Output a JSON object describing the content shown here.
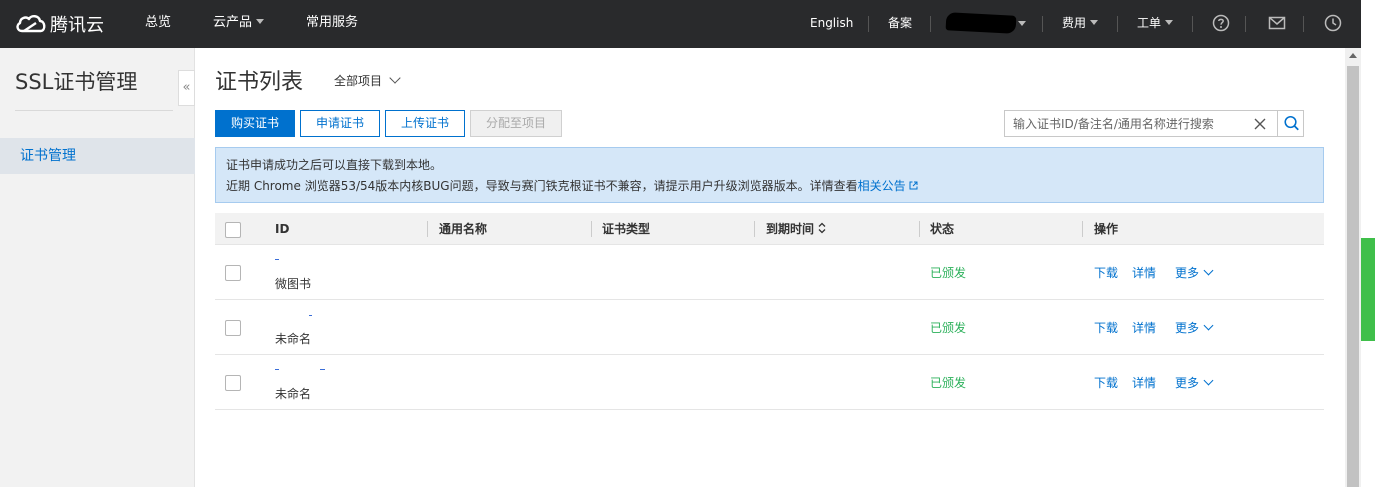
{
  "topbar": {
    "brand": "腾讯云",
    "nav": [
      "总览",
      "云产品",
      "常用服务"
    ],
    "right": {
      "english": "English",
      "beian": "备案",
      "fees": "费用",
      "tickets": "工单"
    }
  },
  "sidebar": {
    "title": "SSL证书管理",
    "collapse_glyph": "«",
    "items": [
      {
        "label": "证书管理"
      }
    ]
  },
  "main": {
    "title": "证书列表",
    "project_selector": "全部项目",
    "buttons": {
      "buy": "购买证书",
      "apply": "申请证书",
      "upload": "上传证书",
      "assign": "分配至项目"
    },
    "search": {
      "placeholder": "输入证书ID/备注名/通用名称进行搜索",
      "value": ""
    },
    "notice": {
      "line1": "证书申请成功之后可以直接下载到本地。",
      "line2": "近期 Chrome 浏览器53/54版本内核BUG问题，导致与赛门铁克根证书不兼容，请提示用户升级浏览器版本。详情查看",
      "link": "相关公告"
    },
    "table": {
      "columns": [
        "ID",
        "通用名称",
        "证书类型",
        "到期时间",
        "状态",
        "操作"
      ],
      "rows": [
        {
          "remark": "微图书",
          "status": "已颁发",
          "actions": [
            "下载",
            "详情",
            "更多"
          ]
        },
        {
          "remark": "未命名",
          "status": "已颁发",
          "actions": [
            "下载",
            "详情",
            "更多"
          ]
        },
        {
          "remark": "未命名",
          "status": "已颁发",
          "actions": [
            "下载",
            "详情",
            "更多"
          ]
        }
      ]
    }
  },
  "colors": {
    "topbar_bg": "#292a2c",
    "accent": "#0071ce",
    "status_green": "#2bb05a",
    "notice_bg": "#d5e7f8"
  }
}
